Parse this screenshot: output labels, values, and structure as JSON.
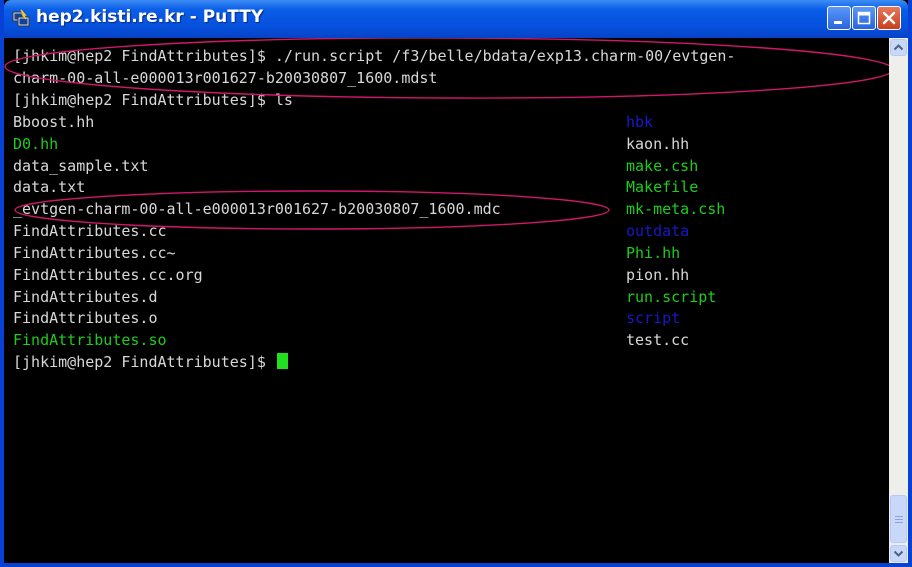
{
  "window": {
    "title": "hep2.kisti.re.kr - PuTTY"
  },
  "terminal": {
    "lines": [
      "[jhkim@hep2 FindAttributes]$ ./run.script /f3/belle/bdata/exp13.charm-00/evtgen-",
      "charm-00-all-e000013r001627-b20030807_1600.mdst",
      "[jhkim@hep2 FindAttributes]$ ls"
    ],
    "listing_left": [
      {
        "name": "Bboost.hh",
        "color": "white"
      },
      {
        "name": "D0.hh",
        "color": "green"
      },
      {
        "name": "data_sample.txt",
        "color": "white"
      },
      {
        "name": "data.txt",
        "color": "white"
      },
      {
        "name": "_evtgen-charm-00-all-e000013r001627-b20030807_1600.mdc",
        "color": "white"
      },
      {
        "name": "FindAttributes.cc",
        "color": "white"
      },
      {
        "name": "FindAttributes.cc~",
        "color": "white"
      },
      {
        "name": "FindAttributes.cc.org",
        "color": "white"
      },
      {
        "name": "FindAttributes.d",
        "color": "white"
      },
      {
        "name": "FindAttributes.o",
        "color": "white"
      },
      {
        "name": "FindAttributes.so",
        "color": "green"
      }
    ],
    "listing_right": [
      {
        "name": "hbk",
        "color": "blue"
      },
      {
        "name": "kaon.hh",
        "color": "white"
      },
      {
        "name": "make.csh",
        "color": "green"
      },
      {
        "name": "Makefile",
        "color": "green"
      },
      {
        "name": "mk-meta.csh",
        "color": "green"
      },
      {
        "name": "outdata",
        "color": "blue"
      },
      {
        "name": "Phi.hh",
        "color": "green"
      },
      {
        "name": "pion.hh",
        "color": "white"
      },
      {
        "name": "run.script",
        "color": "green"
      },
      {
        "name": "script",
        "color": "blue"
      },
      {
        "name": "test.cc",
        "color": "white"
      }
    ],
    "prompt": "[jhkim@hep2 FindAttributes]$ "
  },
  "colors": {
    "titlebar": "#0550dc",
    "terminal_bg": "#000000",
    "text_white": "#d8d8d8",
    "text_green": "#1ccd1c",
    "text_blue": "#1818c8",
    "annotation": "#d0186a"
  },
  "icons": {
    "app": "putty-icon",
    "minimize": "minimize-icon",
    "maximize": "maximize-icon",
    "close": "close-icon",
    "scroll_up": "scroll-up-icon",
    "scroll_down": "scroll-down-icon"
  }
}
